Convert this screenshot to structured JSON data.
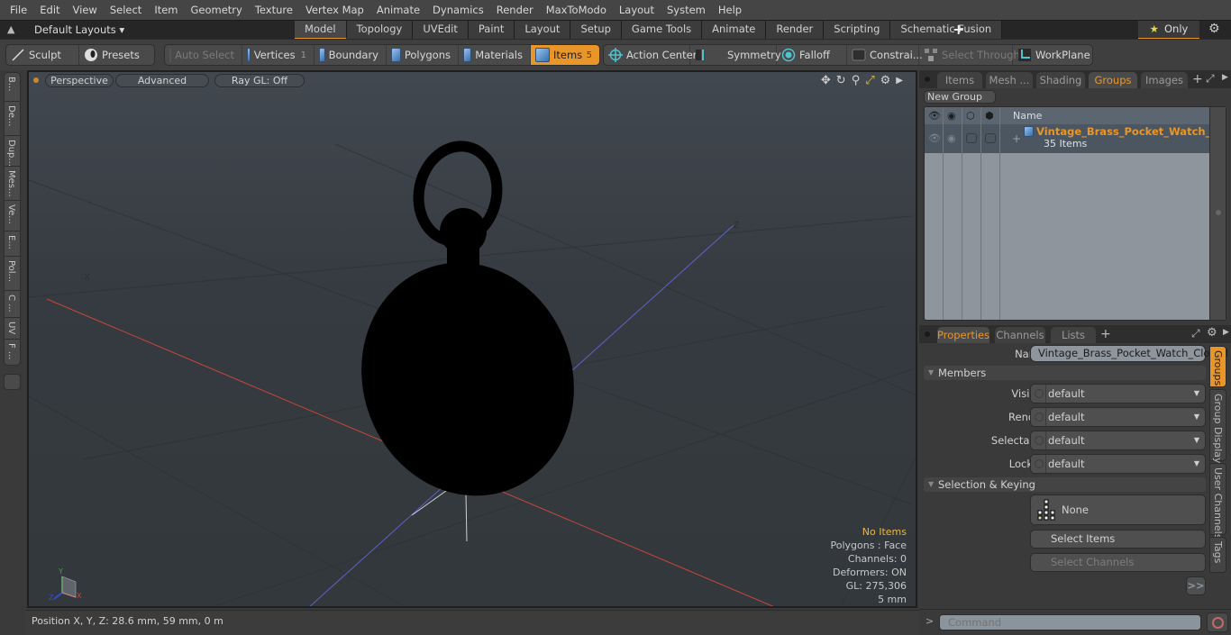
{
  "menu": [
    "File",
    "Edit",
    "View",
    "Select",
    "Item",
    "Geometry",
    "Texture",
    "Vertex Map",
    "Animate",
    "Dynamics",
    "Render",
    "MaxToModo",
    "Layout",
    "System",
    "Help"
  ],
  "layoutbar": {
    "layout_select": "Default Layouts ▾",
    "tabs": [
      "Model",
      "Topology",
      "UVEdit",
      "Paint",
      "Layout",
      "Setup",
      "Game Tools",
      "Animate",
      "Render",
      "Scripting",
      "Schematic Fusion"
    ],
    "active_tab": "Model",
    "add_label": "+",
    "only_label": "Only"
  },
  "toolbar": {
    "sculpt": "Sculpt",
    "presets": "Presets",
    "auto_select": "Auto Select",
    "vertices": "Vertices",
    "vertices_count": "1",
    "boundary": "Boundary",
    "polygons": "Polygons",
    "materials": "Materials",
    "items": "Items",
    "items_count": "5",
    "action_center": "Action Center",
    "symmetry": "Symmetry",
    "falloff": "Falloff",
    "constraints": "Constrai...",
    "select_through": "Select Through",
    "workplane": "WorkPlane"
  },
  "left_strip": [
    "B...",
    "De...",
    "Dup...",
    "Mes...",
    "Ve...",
    "E...",
    "Pol...",
    "C ...",
    "UV",
    "F ..."
  ],
  "viewport": {
    "view_mode": "Perspective",
    "shading": "Advanced",
    "raygl": "Ray GL: Off",
    "axis_labels": {
      "neg_x": "-X",
      "neg_z": "-Z"
    },
    "gizmo": {
      "x": "X",
      "y": "Y",
      "z": "Z"
    },
    "info": {
      "selection": "No Items",
      "polygons": "Polygons : Face",
      "channels": "Channels: 0",
      "deformers": "Deformers: ON",
      "gl": "GL: 275,306",
      "grid": "5 mm"
    },
    "colors": {
      "x_axis": "#c8463c",
      "z_axis": "#5a64c8",
      "object": "#000000"
    }
  },
  "statusbar": {
    "position": "Position X, Y, Z:   28.6 mm, 59 mm, 0 m"
  },
  "groups_panel": {
    "tabs": [
      "Items",
      "Mesh ...",
      "Shading",
      "Groups",
      "Images"
    ],
    "active_tab": "Groups",
    "new_group": "New Group",
    "column_name": "Name",
    "groups": [
      {
        "name": "Vintage_Brass_Pocket_Watch_ ...",
        "count": "35 Items"
      }
    ]
  },
  "properties_panel": {
    "tabs": [
      "Properties",
      "Channels",
      "Lists"
    ],
    "active_tab": "Properties",
    "name_label": "Name",
    "name_value": "Vintage_Brass_Pocket_Watch_Closed",
    "members_section": "Members",
    "fields": [
      {
        "label": "Visible",
        "value": "default"
      },
      {
        "label": "Render",
        "value": "default"
      },
      {
        "label": "Selectable",
        "value": "default"
      },
      {
        "label": "Locked",
        "value": "default"
      }
    ],
    "selection_section": "Selection & Keying",
    "keying_value": "None",
    "select_items": "Select Items",
    "select_channels": "Select Channels",
    "more": ">>",
    "side_tabs": [
      "Groups",
      "Group Display",
      "User Channels",
      "Tags"
    ],
    "active_side_tab": "Groups"
  },
  "command": {
    "prompt": ">",
    "placeholder": "Command"
  },
  "accent_color": "#e8962a"
}
